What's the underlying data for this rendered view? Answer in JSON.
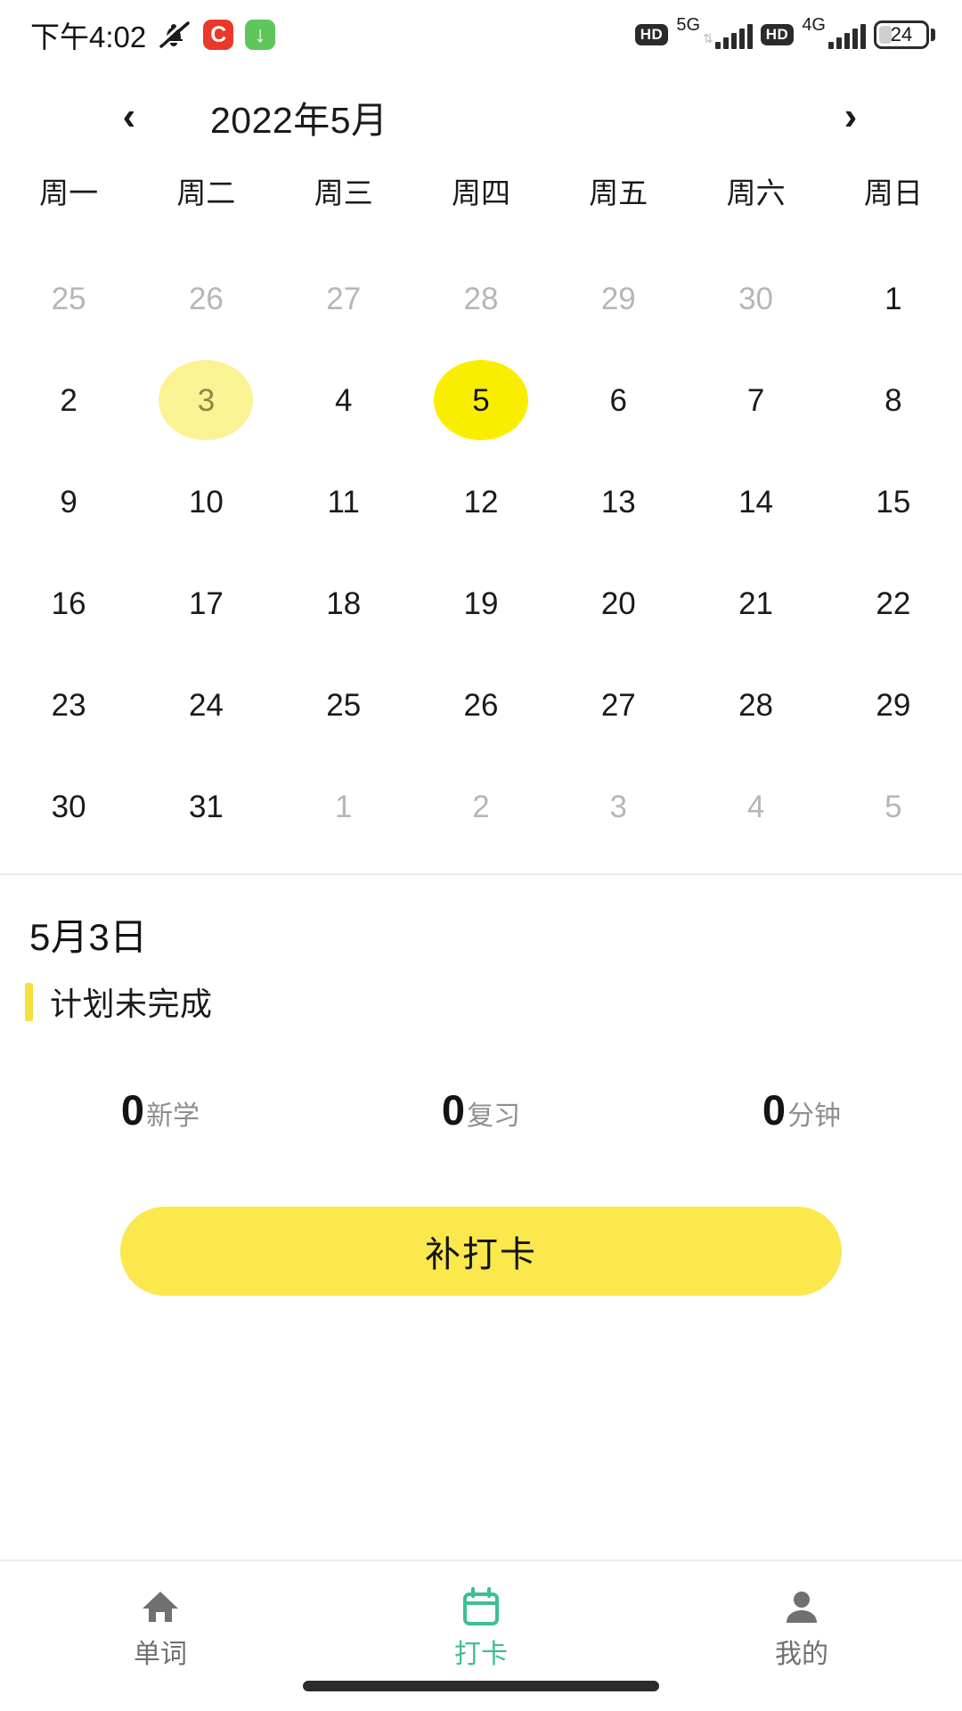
{
  "status_bar": {
    "time": "下午4:02",
    "mute_icon": "bell-muted-icon",
    "app_icon_1": "C",
    "app_icon_2": "↓",
    "hd_1": "HD",
    "network_1": "5G",
    "hd_2": "HD",
    "network_2": "4G",
    "battery_level": "24"
  },
  "calendar": {
    "prev_label": "‹",
    "next_label": "›",
    "title": "2022年5月",
    "weekdays": [
      "周一",
      "周二",
      "周三",
      "周四",
      "周五",
      "周六",
      "周日"
    ],
    "days": [
      {
        "n": "25",
        "state": "muted"
      },
      {
        "n": "26",
        "state": "muted"
      },
      {
        "n": "27",
        "state": "muted"
      },
      {
        "n": "28",
        "state": "muted"
      },
      {
        "n": "29",
        "state": "muted"
      },
      {
        "n": "30",
        "state": "muted"
      },
      {
        "n": "1",
        "state": "normal"
      },
      {
        "n": "2",
        "state": "normal"
      },
      {
        "n": "3",
        "state": "selected"
      },
      {
        "n": "4",
        "state": "normal"
      },
      {
        "n": "5",
        "state": "today"
      },
      {
        "n": "6",
        "state": "normal"
      },
      {
        "n": "7",
        "state": "normal"
      },
      {
        "n": "8",
        "state": "normal"
      },
      {
        "n": "9",
        "state": "normal"
      },
      {
        "n": "10",
        "state": "normal"
      },
      {
        "n": "11",
        "state": "normal"
      },
      {
        "n": "12",
        "state": "normal"
      },
      {
        "n": "13",
        "state": "normal"
      },
      {
        "n": "14",
        "state": "normal"
      },
      {
        "n": "15",
        "state": "normal"
      },
      {
        "n": "16",
        "state": "normal"
      },
      {
        "n": "17",
        "state": "normal"
      },
      {
        "n": "18",
        "state": "normal"
      },
      {
        "n": "19",
        "state": "normal"
      },
      {
        "n": "20",
        "state": "normal"
      },
      {
        "n": "21",
        "state": "normal"
      },
      {
        "n": "22",
        "state": "normal"
      },
      {
        "n": "23",
        "state": "normal"
      },
      {
        "n": "24",
        "state": "normal"
      },
      {
        "n": "25",
        "state": "normal"
      },
      {
        "n": "26",
        "state": "normal"
      },
      {
        "n": "27",
        "state": "normal"
      },
      {
        "n": "28",
        "state": "normal"
      },
      {
        "n": "29",
        "state": "normal"
      },
      {
        "n": "30",
        "state": "normal"
      },
      {
        "n": "31",
        "state": "normal"
      },
      {
        "n": "1",
        "state": "muted"
      },
      {
        "n": "2",
        "state": "muted"
      },
      {
        "n": "3",
        "state": "muted"
      },
      {
        "n": "4",
        "state": "muted"
      },
      {
        "n": "5",
        "state": "muted"
      }
    ],
    "today_color": "#faee00",
    "selected_color": "#fbf293"
  },
  "detail": {
    "date": "5月3日",
    "plan_status": "计划未完成",
    "accent_color": "#f6e03c",
    "stats": [
      {
        "value": "0",
        "label": "新学"
      },
      {
        "value": "0",
        "label": "复习"
      },
      {
        "value": "0",
        "label": "分钟"
      }
    ],
    "cta_label": "补打卡",
    "cta_color": "#fae84c"
  },
  "nav": {
    "active_color": "#3dbf92",
    "items": [
      {
        "label": "单词",
        "icon": "home-icon"
      },
      {
        "label": "打卡",
        "icon": "calendar-icon"
      },
      {
        "label": "我的",
        "icon": "person-icon"
      }
    ]
  }
}
